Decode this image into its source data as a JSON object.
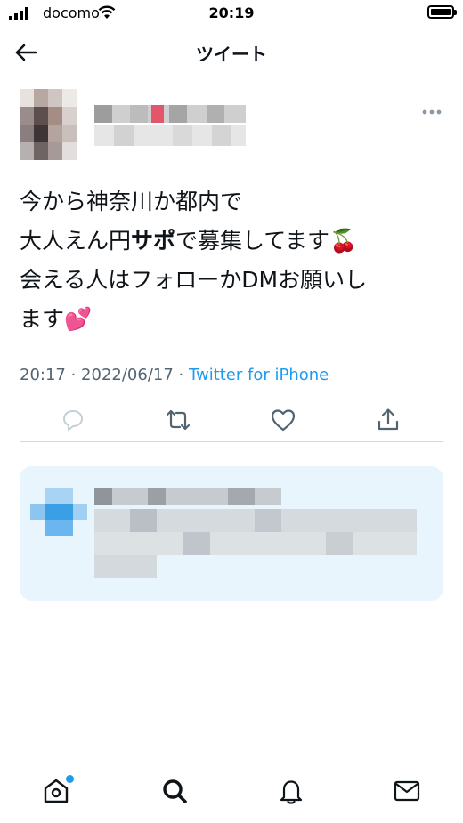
{
  "status_bar": {
    "carrier": "docomo",
    "time": "20:19"
  },
  "header": {
    "title": "ツイート"
  },
  "tweet": {
    "line1": "今から神奈川か都内で",
    "line2_before": "大人えん円",
    "line2_bold": "サポ",
    "line2_after": "で募集してます",
    "line2_emoji": "🍒",
    "line3": "会える人はフォローかDMお願いし",
    "line4": "ます",
    "line4_emoji": "💕",
    "time": "20:17 · 2022/06/17 · ",
    "source": "Twitter for iPhone"
  },
  "colors": {
    "accent": "#1d9bf0",
    "card_bg": "#e8f5fd",
    "muted": "#536471"
  },
  "icons": {
    "actions": [
      "reply-icon",
      "retweet-icon",
      "like-icon",
      "share-icon"
    ],
    "nav": [
      "home-icon",
      "search-icon",
      "notifications-icon",
      "messages-icon"
    ]
  }
}
